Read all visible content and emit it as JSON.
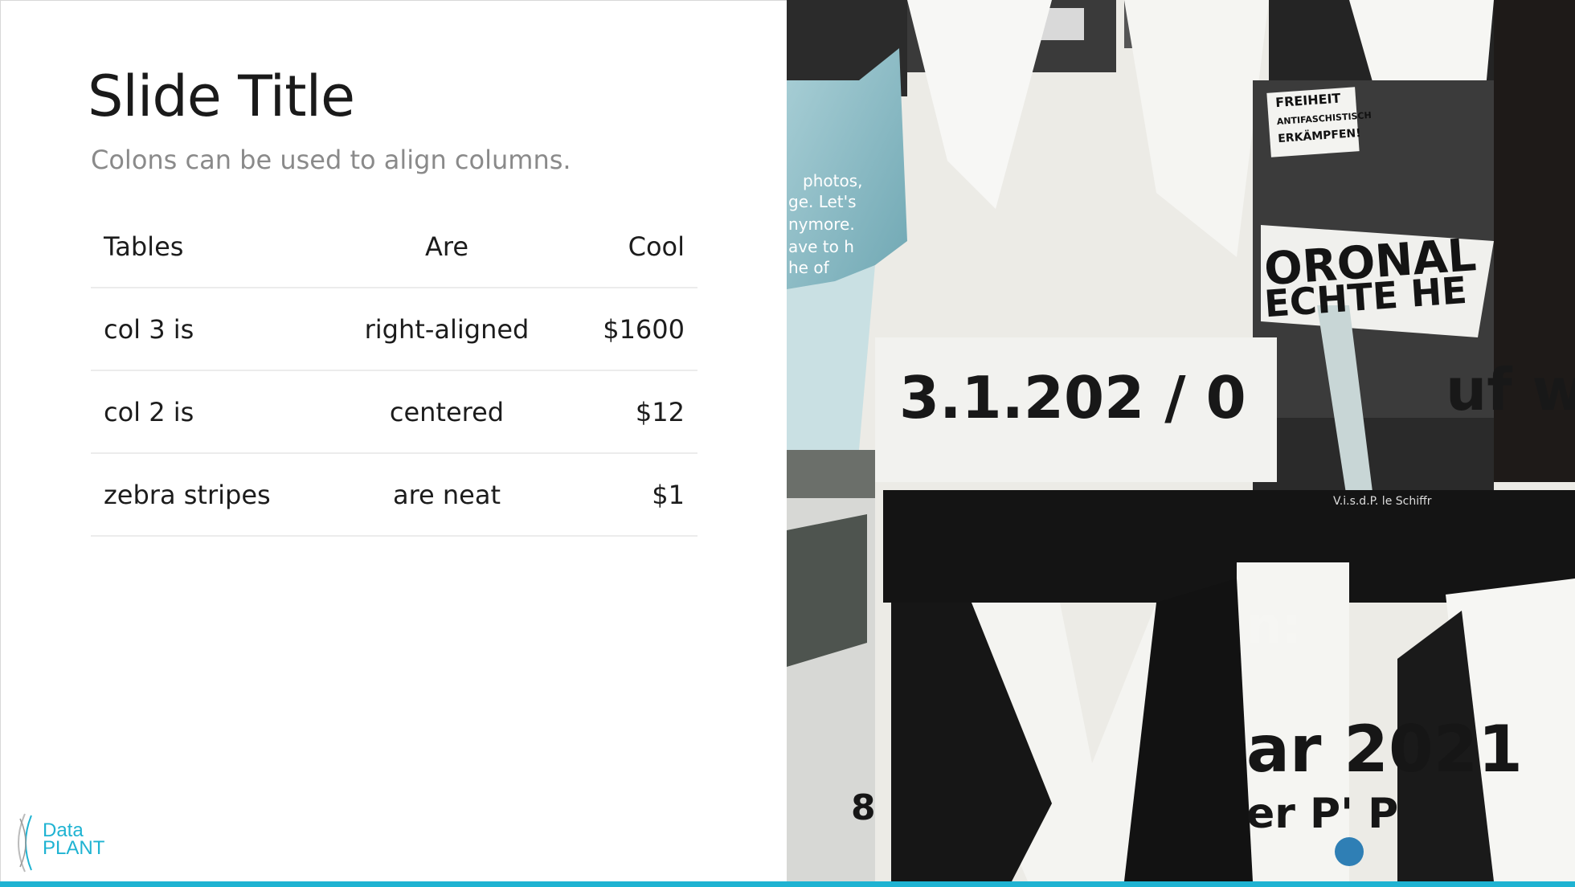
{
  "slide": {
    "title": "Slide Title",
    "subtitle": "Colons can be used to align columns."
  },
  "table": {
    "headers": [
      "Tables",
      "Are",
      "Cool"
    ],
    "rows": [
      [
        "col 3 is",
        "right-aligned",
        "$1600"
      ],
      [
        "col 2 is",
        "centered",
        "$12"
      ],
      [
        "zebra stripes",
        "are neat",
        "$1"
      ]
    ]
  },
  "logo": {
    "line1": "Data",
    "line2": "PLANT"
  },
  "collage": {
    "sign_text": "FREIHEIT ANTIFASCHISTISCH ERKÄMPFEN!",
    "banner_text": "ORONAL ECHTE HE",
    "date_text": "3.1.202 / 0",
    "uf_text": "uf w",
    "n_text": "n:",
    "ar_text": "ar 2021",
    "er_text": "er P' P",
    "blue_text": "photos, ge. Let's nymore. ave to h he of",
    "footer_text": "V.i.s.d.P. le Schiffr",
    "eight_text": "8"
  },
  "colors": {
    "accent": "#1fb3d2",
    "subtitle": "#8a8a8a",
    "title": "#1a1a1a"
  }
}
